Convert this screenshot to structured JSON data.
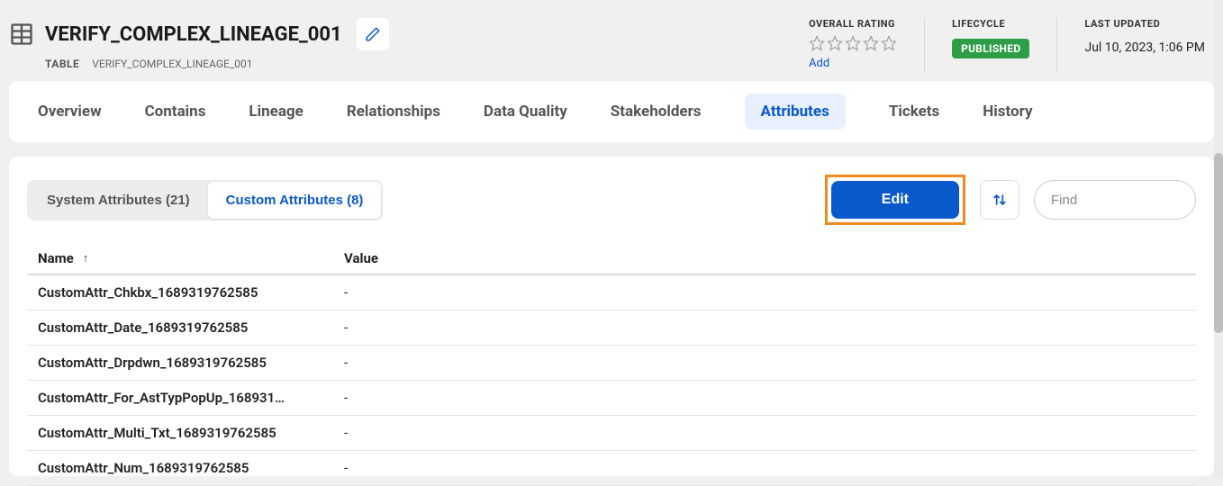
{
  "header": {
    "title": "VERIFY_COMPLEX_LINEAGE_001",
    "type_label": "TABLE",
    "breadcrumb_name": "VERIFY_COMPLEX_LINEAGE_001"
  },
  "meta": {
    "rating": {
      "label": "OVERALL RATING",
      "add_link": "Add"
    },
    "lifecycle": {
      "label": "LIFECYCLE",
      "value": "PUBLISHED"
    },
    "updated": {
      "label": "LAST UPDATED",
      "value": "Jul 10, 2023, 1:06 PM"
    }
  },
  "tabs": [
    {
      "label": "Overview"
    },
    {
      "label": "Contains"
    },
    {
      "label": "Lineage"
    },
    {
      "label": "Relationships"
    },
    {
      "label": "Data Quality"
    },
    {
      "label": "Stakeholders"
    },
    {
      "label": "Attributes",
      "active": true
    },
    {
      "label": "Tickets"
    },
    {
      "label": "History"
    }
  ],
  "toggle": {
    "system_label": "System Attributes (21)",
    "custom_label": "Custom Attributes (8)"
  },
  "actions": {
    "edit_label": "Edit",
    "find_placeholder": "Find"
  },
  "table": {
    "columns": {
      "name": "Name",
      "value": "Value"
    },
    "rows": [
      {
        "name": "CustomAttr_Chkbx_1689319762585",
        "value": "-"
      },
      {
        "name": "CustomAttr_Date_1689319762585",
        "value": "-"
      },
      {
        "name": "CustomAttr_Drpdwn_1689319762585",
        "value": "-"
      },
      {
        "name": "CustomAttr_For_AstTypPopUp_168931…",
        "value": "-"
      },
      {
        "name": "CustomAttr_Multi_Txt_1689319762585",
        "value": "-"
      },
      {
        "name": "CustomAttr_Num_1689319762585",
        "value": "-"
      }
    ]
  }
}
